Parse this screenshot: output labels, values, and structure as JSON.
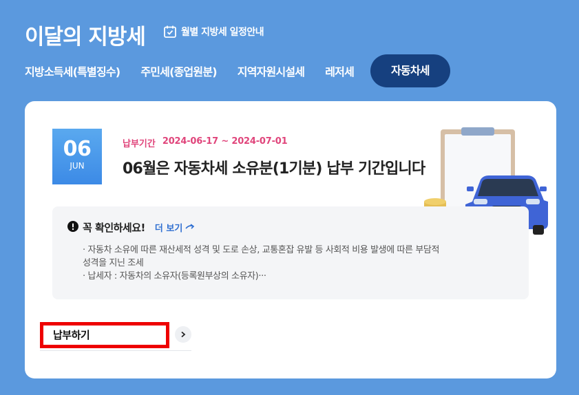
{
  "header": {
    "title": "이달의 지방세",
    "schedule_label": "월별 지방세 일정안내",
    "schedule_icon": "calendar-check-icon"
  },
  "tabs": [
    {
      "label": "지방소득세(특별징수)",
      "active": false
    },
    {
      "label": "주민세(종업원분)",
      "active": false
    },
    {
      "label": "지역자원시설세",
      "active": false
    },
    {
      "label": "레저세",
      "active": false
    },
    {
      "label": "자동차세",
      "active": true
    }
  ],
  "card": {
    "date_badge": {
      "day": "06",
      "month": "JUN"
    },
    "period_label": "납부기간",
    "period_dates": "2024-06-17 ~ 2024-07-01",
    "headline": "06월은 자동차세 소유분(1기분) 납부 기간입니다",
    "notice": {
      "icon": "exclamation-circle-icon",
      "title": "꼭 확인하세요!",
      "more_label": "더 보기",
      "lines": [
        "· 자동차 소유에 따른 재산세적 성격 및 도로 손상, 교통혼잡 유발 등 사회적 비용 발생에 따른 부담적",
        "성격을 지닌 조세",
        "· 납세자 : 자동차의 소유자(등록원부상의 소유자)···"
      ]
    },
    "pay": {
      "label": "납부하기",
      "icon": "chevron-right-icon"
    }
  },
  "colors": {
    "background": "#5b99de",
    "active_tab": "#16407f",
    "period": "#e0457b",
    "badge": "#3c8ae6",
    "link": "#2f6fd1",
    "highlight": "#ee0000"
  }
}
